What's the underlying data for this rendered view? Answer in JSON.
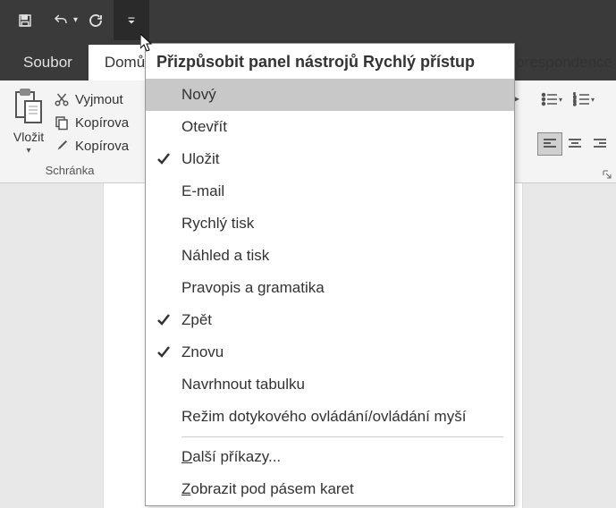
{
  "titlebar": {
    "save": "Uložit",
    "undo": "Zpět",
    "repeat": "Znovu"
  },
  "tabs": {
    "file": "Soubor",
    "home": "Domů",
    "correspondence": "orespondence"
  },
  "ribbon": {
    "paste": "Vložit",
    "cut": "Vyjmout",
    "copy": "Kopírova",
    "copy_format": "Kopírova",
    "clipboard_group": "Schránka"
  },
  "dropdown": {
    "title": "Přizpůsobit panel nástrojů Rychlý přístup",
    "items": [
      {
        "label": "Nový",
        "checked": false,
        "highlighted": true
      },
      {
        "label": "Otevřít",
        "checked": false,
        "highlighted": false
      },
      {
        "label": "Uložit",
        "checked": true,
        "highlighted": false
      },
      {
        "label": "E-mail",
        "checked": false,
        "highlighted": false
      },
      {
        "label": "Rychlý tisk",
        "checked": false,
        "highlighted": false
      },
      {
        "label": "Náhled a tisk",
        "checked": false,
        "highlighted": false
      },
      {
        "label": "Pravopis a gramatika",
        "checked": false,
        "highlighted": false
      },
      {
        "label": "Zpět",
        "checked": true,
        "highlighted": false
      },
      {
        "label": "Znovu",
        "checked": true,
        "highlighted": false
      },
      {
        "label": "Navrhnout tabulku",
        "checked": false,
        "highlighted": false
      },
      {
        "label": "Režim dotykového ovládání/ovládání myší",
        "checked": false,
        "highlighted": false
      }
    ],
    "more_commands": "Další příkazy...",
    "show_below": "Zobrazit pod pásem karet"
  }
}
